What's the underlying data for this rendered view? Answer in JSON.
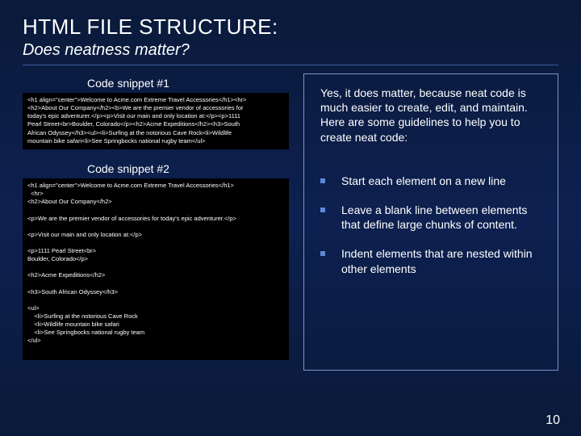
{
  "title": "HTML FILE STRUCTURE:",
  "subtitle": "Does neatness matter?",
  "snippet1_label": "Code snippet #1",
  "snippet2_label": "Code snippet #2",
  "code1": "<h1 align=\"center\">Welcome to Acme.com Extreme Travel Accessories</h1><hr>\n<h2>About Our Company</h2><b>We are the premier vendor of accessories for\ntoday's epic adventurer.</p><p>Visit our main and only location at:</p><p>1111\nPearl Street<br>Boulder, Colorado</p><h2>Acme Expeditions</h2><h3>South\nAfrican Odyssey</h3><ul><li>Surfing at the notorious Cave Rock<li>Wildlife\nmountain bike safari<li>See Springbocks national rugby team</ul>",
  "code2": "<h1 align=\"center\">Welcome to Acme.com Extreme Travel Accessories</h1>\n  <hr>\n<h2>About Our Company</h2>\n\n<p>We are the premier vendor of accessories for today's epic adventurer.</p>\n\n<p>Visit our main and only location at:</p>\n\n<p>1111 Pearl Street<br>\nBoulder, Colorado</p>\n\n<h2>Acme Expeditions</h2>\n\n<h3>South African Odyssey</h3>\n\n<ul>\n    <li>Surfing at the notorious Cave Rock\n    <li>Wildlife mountain bike safari\n    <li>See Springbocks national rugby team\n</ul>",
  "intro": "Yes, it does matter, because neat code is much easier to create, edit, and maintain.  Here are some guidelines to help you to create neat code:",
  "bullets": [
    "Start each element on a new line",
    "Leave a blank line between elements that define large chunks of content.",
    "Indent elements that are nested within other elements"
  ],
  "page_number": "10"
}
